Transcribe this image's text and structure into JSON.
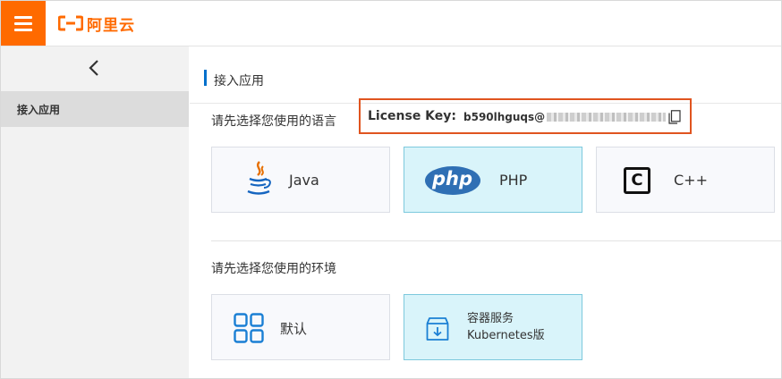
{
  "header": {
    "brand": "阿里云",
    "brand_color": "#ff6a00",
    "menu_icon": "hamburger-menu-icon"
  },
  "sidebar": {
    "collapse_icon": "chevron-left-icon",
    "items": [
      {
        "label": "接入应用",
        "active": true
      }
    ]
  },
  "main": {
    "title": "接入应用",
    "language_prompt": "请先选择您使用的语言",
    "license": {
      "label": "License Key:",
      "value_visible": "b590lhguqs@",
      "masked": true,
      "copy_icon": "copy-icon",
      "highlight_color": "#e0541f"
    },
    "languages": [
      {
        "label": "Java",
        "icon": "java-icon",
        "selected": false
      },
      {
        "label": "PHP",
        "icon": "php-icon",
        "icon_text": "php",
        "selected": true
      },
      {
        "label": "C++",
        "icon": "cpp-icon",
        "icon_text": "C",
        "selected": false
      }
    ],
    "environment_prompt": "请先选择您使用的环境",
    "environments": [
      {
        "label": "默认",
        "icon": "grid-icon",
        "selected": false
      },
      {
        "label_line1": "容器服务",
        "label_line2": "Kubernetes版",
        "icon": "container-box-icon",
        "selected": true
      }
    ],
    "accent_color": "#0070cc",
    "selected_bg": "#d9f4fa"
  }
}
